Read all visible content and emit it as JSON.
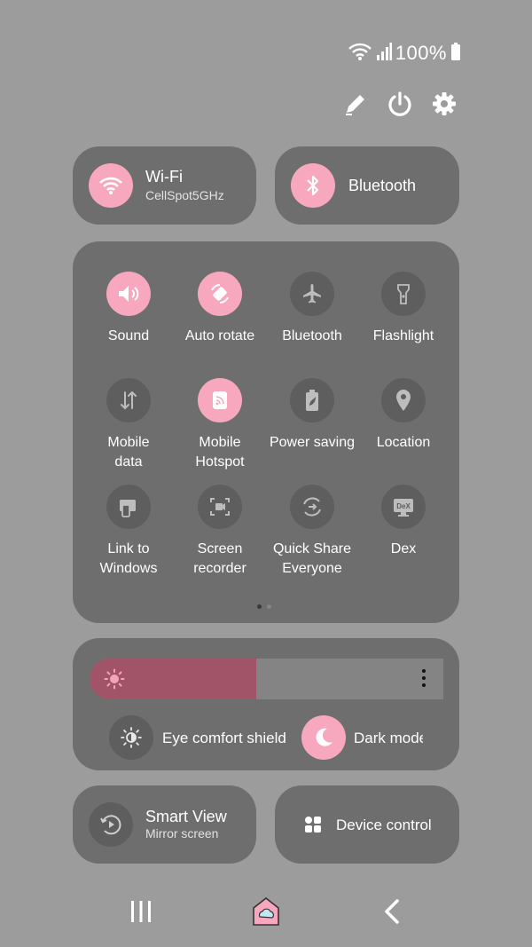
{
  "status": {
    "battery": "100%",
    "icons": [
      "wifi-icon",
      "signal-icon",
      "battery-icon"
    ]
  },
  "actions": {
    "icons": [
      "pencil-icon",
      "power-icon",
      "settings-icon"
    ]
  },
  "wifi": {
    "title": "Wi-Fi",
    "subtitle": "CellSpot5GHz",
    "state": "on"
  },
  "bluetooth_pill": {
    "title": "Bluetooth",
    "state": "on"
  },
  "tiles": [
    {
      "label": "Sound",
      "icon": "sound-icon",
      "state": "on"
    },
    {
      "label": "Auto rotate",
      "icon": "auto-rotate-icon",
      "state": "on"
    },
    {
      "label": "Bluetooth",
      "icon": "airplane-icon",
      "state": "off"
    },
    {
      "label": "Flashlight",
      "icon": "flashlight-icon",
      "state": "off"
    },
    {
      "label": "Mobile\ndata",
      "icon": "mobile-data-icon",
      "state": "off"
    },
    {
      "label": "Mobile\nHotspot",
      "icon": "hotspot-icon",
      "state": "on"
    },
    {
      "label": "Power saving",
      "icon": "power-saving-icon",
      "state": "off"
    },
    {
      "label": "Location",
      "icon": "location-icon",
      "state": "off"
    },
    {
      "label": "Link to\nWindows",
      "icon": "link-windows-icon",
      "state": "off"
    },
    {
      "label": "Screen\nrecorder",
      "icon": "screen-recorder-icon",
      "state": "off"
    },
    {
      "label": "Quick Share\nEveryone",
      "icon": "quick-share-icon",
      "state": "off"
    },
    {
      "label": "Dex",
      "icon": "dex-icon",
      "state": "off"
    }
  ],
  "page_indicator": {
    "current": 1,
    "total": 2
  },
  "brightness": {
    "level": 0.47
  },
  "eye_comfort": {
    "label": "Eye comfort shield",
    "state": "off"
  },
  "dark_mode": {
    "label": "Dark mode",
    "state": "on"
  },
  "smart_view": {
    "title": "Smart View",
    "subtitle": "Mirror screen"
  },
  "device_control": {
    "title": "Device control"
  },
  "nav": {
    "icons": [
      "recents-icon",
      "home-icon",
      "back-icon"
    ]
  },
  "colors": {
    "accent": "#f7a8bf",
    "panel": "#6e6e6e",
    "background": "#9c9c9c",
    "brightness_fill": "#a15468"
  }
}
